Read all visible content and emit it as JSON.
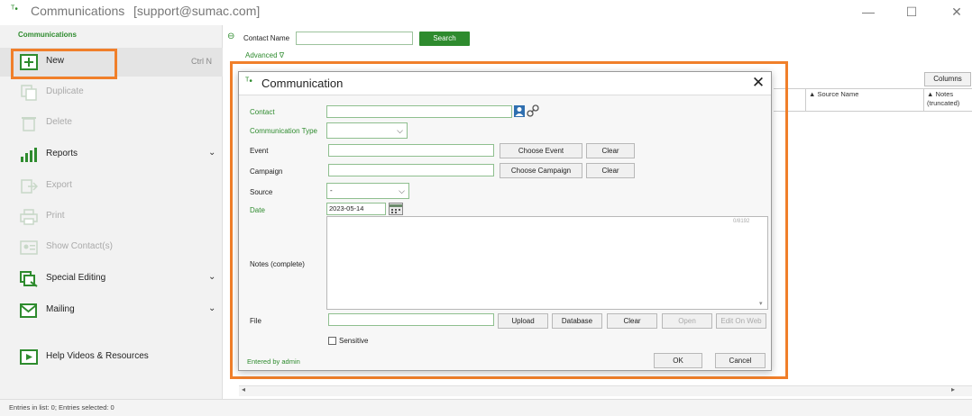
{
  "window": {
    "title": "Communications",
    "user": "[support@sumac.com]",
    "minimize": "—",
    "maximize": "☐",
    "close": "✕"
  },
  "sidebar": {
    "heading": "Communications",
    "items": [
      {
        "label": "New",
        "shortcut": "Ctrl N",
        "enabled": true
      },
      {
        "label": "Duplicate",
        "enabled": false
      },
      {
        "label": "Delete",
        "enabled": false
      },
      {
        "label": "Reports",
        "enabled": true,
        "has_submenu": true
      },
      {
        "label": "Export",
        "enabled": false
      },
      {
        "label": "Print",
        "enabled": false
      },
      {
        "label": "Show Contact(s)",
        "enabled": false
      },
      {
        "label": "Special Editing",
        "enabled": true,
        "has_submenu": true
      },
      {
        "label": "Mailing",
        "enabled": true,
        "has_submenu": true
      },
      {
        "label": "Help Videos & Resources",
        "enabled": true
      }
    ],
    "chevron": "⌄"
  },
  "search": {
    "contact_label": "Contact Name",
    "search_button": "Search",
    "advanced_link": "Advanced ∇"
  },
  "grid": {
    "columns_button": "Columns",
    "headers": [
      "Source Name",
      "Notes (truncated)"
    ],
    "sort_glyph": "▲",
    "scroll_left": "◂",
    "scroll_right": "▸"
  },
  "dialog": {
    "title": "Communication",
    "close": "✕",
    "fields": {
      "contact": "Contact",
      "communication_type": "Communication Type",
      "event": "Event",
      "campaign": "Campaign",
      "source": "Source",
      "date": "Date",
      "notes": "Notes (complete)",
      "file": "File"
    },
    "values": {
      "source": "-",
      "date": "2023-05-14",
      "notes_counter": "0/8192"
    },
    "buttons": {
      "choose_event": "Choose Event",
      "clear_event": "Clear",
      "choose_campaign": "Choose Campaign",
      "clear_campaign": "Clear",
      "upload": "Upload",
      "database": "Database",
      "clear_file": "Clear",
      "open": "Open",
      "edit_on_web": "Edit On Web",
      "ok": "OK",
      "cancel": "Cancel"
    },
    "sensitive_label": "Sensitive",
    "entered_by": "Entered by admin"
  },
  "status": {
    "text": "Entries in list: 0; Entries selected: 0"
  },
  "colors": {
    "accent_green": "#2e8b2e",
    "highlight_orange": "#f07f2a"
  }
}
